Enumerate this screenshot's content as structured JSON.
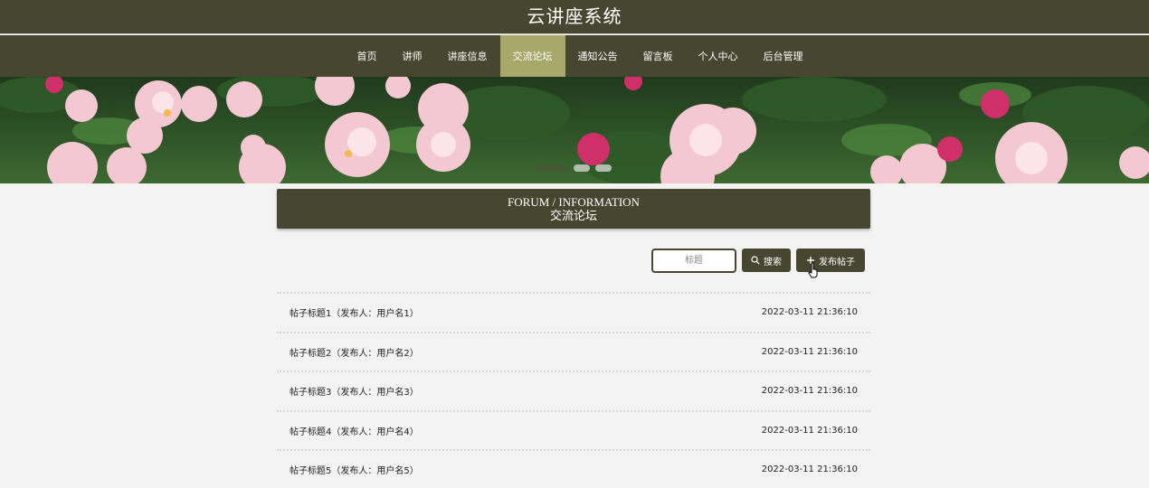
{
  "header": {
    "site_title": "云讲座系统"
  },
  "nav": {
    "items": [
      {
        "label": "首页",
        "active": false
      },
      {
        "label": "讲师",
        "active": false
      },
      {
        "label": "讲座信息",
        "active": false
      },
      {
        "label": "交流论坛",
        "active": true
      },
      {
        "label": "通知公告",
        "active": false
      },
      {
        "label": "留言板",
        "active": false
      },
      {
        "label": "个人中心",
        "active": false
      },
      {
        "label": "后台管理",
        "active": false
      }
    ]
  },
  "section": {
    "title_en": "FORUM / INFORMATION",
    "title_cn": "交流论坛"
  },
  "search": {
    "placeholder": "标题",
    "button_label": "搜索",
    "publish_label": "发布帖子"
  },
  "posts": [
    {
      "title": "帖子标题1（发布人：用户名1）",
      "time": "2022-03-11 21:36:10"
    },
    {
      "title": "帖子标题2（发布人：用户名2）",
      "time": "2022-03-11 21:36:10"
    },
    {
      "title": "帖子标题3（发布人：用户名3）",
      "time": "2022-03-11 21:36:10"
    },
    {
      "title": "帖子标题4（发布人：用户名4）",
      "time": "2022-03-11 21:36:10"
    },
    {
      "title": "帖子标题5（发布人：用户名5）",
      "time": "2022-03-11 21:36:10"
    }
  ],
  "colors": {
    "primary": "#474630",
    "active": "#a8a86b",
    "background": "#f3f3f3"
  }
}
